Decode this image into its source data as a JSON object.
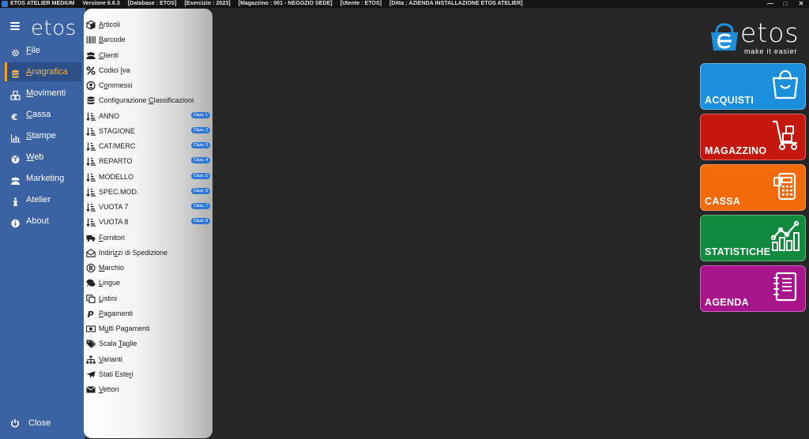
{
  "titlebar": {
    "app": "ETOS ATELIER MEDIUM",
    "version": "Versione 6.6.3",
    "database": "[Database : ETOS]",
    "esercizio": "[Esercizio : 2023]",
    "magazzino": "[Magazzino : 001 - NEGOZIO SEDE]",
    "utente": "[Utente : ETOS]",
    "ditta": "[Ditta : AZIENDA INSTALLAZIONE ETOS ATELIER]",
    "min": "—",
    "max": "□",
    "close": "✕"
  },
  "sidebar": {
    "logo": "etos",
    "items": [
      {
        "label": "File",
        "acc": "F",
        "rest": "ile",
        "icon": "gear-icon"
      },
      {
        "label": "Anagrafica",
        "acc": "A",
        "rest": "nagrafica",
        "icon": "database-icon",
        "active": true
      },
      {
        "label": "Movimenti",
        "acc": "M",
        "rest": "ovimenti",
        "icon": "cubes-icon"
      },
      {
        "label": "Cassa",
        "acc": "C",
        "rest": "assa",
        "icon": "euro-icon"
      },
      {
        "label": "Stampe",
        "acc": "S",
        "rest": "tampe",
        "icon": "chart-icon"
      },
      {
        "label": "Web",
        "acc": "W",
        "rest": "eb",
        "icon": "globe-icon"
      },
      {
        "label": "Marketing",
        "acc": "",
        "rest": "Marketing",
        "icon": "users-icon"
      },
      {
        "label": "Atelier",
        "acc": "",
        "rest": "Atelier",
        "icon": "mannequin-icon"
      },
      {
        "label": "About",
        "acc": "",
        "rest": "About",
        "icon": "info-icon"
      }
    ],
    "close_label": "Close"
  },
  "submenu": {
    "items": [
      {
        "pre": "",
        "acc": "A",
        "post": "rticoli",
        "icon": "box-icon"
      },
      {
        "pre": "",
        "acc": "B",
        "post": "arcode",
        "icon": "barcode-icon"
      },
      {
        "pre": "",
        "acc": "C",
        "post": "lienti",
        "icon": "users-icon"
      },
      {
        "pre": "Codici ",
        "acc": "I",
        "post": "va",
        "icon": "percent-icon"
      },
      {
        "pre": "C",
        "acc": "o",
        "post": "mmessi",
        "icon": "user-circle-icon"
      },
      {
        "pre": "Configurazione ",
        "acc": "C",
        "post": "lassificazioni",
        "icon": "database-icon"
      },
      {
        "pre": "ANNO",
        "acc": "",
        "post": "",
        "icon": "sort-icon",
        "badge": "Class. 1"
      },
      {
        "pre": "STAGIONE",
        "acc": "",
        "post": "",
        "icon": "sort-icon",
        "badge": "Class. 2"
      },
      {
        "pre": "CAT/MERC",
        "acc": "",
        "post": "",
        "icon": "sort-icon",
        "badge": "Class. 3"
      },
      {
        "pre": "REPARTO",
        "acc": "",
        "post": "",
        "icon": "sort-icon",
        "badge": "Class. 4"
      },
      {
        "pre": "MODELLO",
        "acc": "",
        "post": "",
        "icon": "sort-icon",
        "badge": "Class. 5"
      },
      {
        "pre": "SPEC.MOD.",
        "acc": "",
        "post": "",
        "icon": "sort-icon",
        "badge": "Class. 6"
      },
      {
        "pre": "VUOTA 7",
        "acc": "",
        "post": "",
        "icon": "sort-icon",
        "badge": "Class. 7"
      },
      {
        "pre": "VUOTA 8",
        "acc": "",
        "post": "",
        "icon": "sort-icon",
        "badge": "Class. 8"
      },
      {
        "pre": "",
        "acc": "F",
        "post": "ornitori",
        "icon": "truck-icon"
      },
      {
        "pre": "Indiri",
        "acc": "z",
        "post": "zi di Spedizione",
        "icon": "envelope-open-icon"
      },
      {
        "pre": "",
        "acc": "M",
        "post": "archio",
        "icon": "registered-icon"
      },
      {
        "pre": "",
        "acc": "L",
        "post": "ingue",
        "icon": "comments-icon"
      },
      {
        "pre": "",
        "acc": "L",
        "post": "istini",
        "icon": "copy-icon"
      },
      {
        "pre": "",
        "acc": "P",
        "post": "agamenti",
        "icon": "paypal-icon"
      },
      {
        "pre": "M",
        "acc": "u",
        "post": "lti Pagamenti",
        "icon": "money-icon"
      },
      {
        "pre": "Scala ",
        "acc": "T",
        "post": "aglie",
        "icon": "tags-icon"
      },
      {
        "pre": "",
        "acc": "V",
        "post": "arianti",
        "icon": "sitemap-icon"
      },
      {
        "pre": "Stati Este",
        "acc": "r",
        "post": "i",
        "icon": "plane-icon"
      },
      {
        "pre": "",
        "acc": "V",
        "post": "ettori",
        "icon": "envelope-icon"
      }
    ]
  },
  "brand": {
    "name": "etos",
    "tagline": "make it easier"
  },
  "tiles": [
    {
      "label": "ACQUISTI",
      "color": "#1b8fdc",
      "icon": "shopping-bag-icon"
    },
    {
      "label": "MAGAZZINO",
      "color": "#c4170d",
      "icon": "hand-truck-icon"
    },
    {
      "label": "CASSA",
      "color": "#f26a0a",
      "icon": "pos-terminal-icon"
    },
    {
      "label": "STATISTICHE",
      "color": "#128a3e",
      "icon": "stats-chart-icon"
    },
    {
      "label": "AGENDA",
      "color": "#a8148c",
      "icon": "notebook-icon"
    }
  ]
}
